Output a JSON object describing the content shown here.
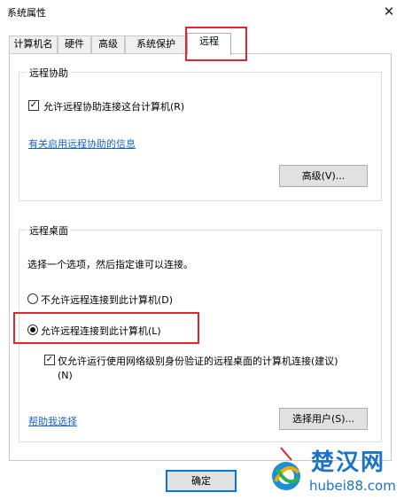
{
  "window": {
    "title": "系统属性",
    "close_glyph": "✕"
  },
  "tabs": [
    {
      "label": "计算机名"
    },
    {
      "label": "硬件"
    },
    {
      "label": "高级"
    },
    {
      "label": "系统保护"
    },
    {
      "label": "远程",
      "selected": true
    }
  ],
  "remote_assistance": {
    "title": "远程协助",
    "allow_label": "允许远程协助连接这台计算机(R)",
    "allow_checked": true,
    "info_link": "有关启用远程协助的信息",
    "advanced_button": "高级(V)..."
  },
  "remote_desktop": {
    "title": "远程桌面",
    "instruction": "选择一个选项，然后指定谁可以连接。",
    "deny_label": "不允许远程连接到此计算机(D)",
    "allow_label": "允许远程连接到此计算机(L)",
    "selected_option": "allow",
    "nla_label_line1": "仅允许运行使用网络级别身份验证的远程桌面的计算机连接(建议)",
    "nla_label_line2": "(N)",
    "nla_checked": true,
    "help_link": "帮助我选择",
    "select_users_button": "选择用户(S)..."
  },
  "footer": {
    "ok_button": "确定"
  },
  "watermark": {
    "text_cn": "楚汉网",
    "url": "hubei88.com"
  },
  "colors": {
    "highlight": "#e1272d",
    "link": "#1a63c5",
    "accent": "#0078d7"
  }
}
